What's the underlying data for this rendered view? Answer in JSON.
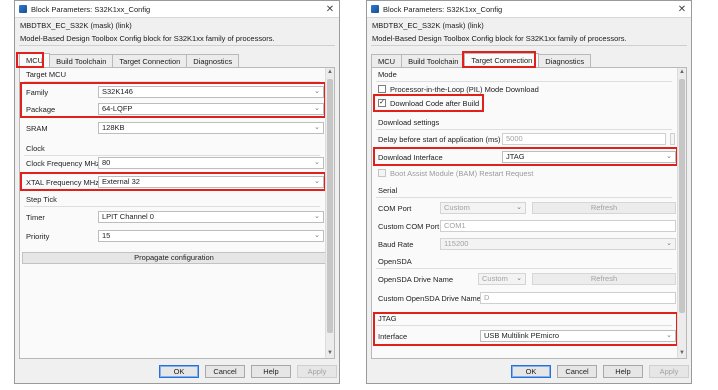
{
  "left": {
    "title": "Block Parameters: S32K1xx_Config",
    "block_name": "MBDTBX_EC_S32K (mask) (link)",
    "description": "Model-Based Design Toolbox Config block for S32K1xx family of processors.",
    "tabs": [
      "MCU",
      "Build Toolchain",
      "Target Connection",
      "Diagnostics"
    ],
    "target_mcu": {
      "title": "Target MCU",
      "family_label": "Family",
      "family_value": "S32K146",
      "package_label": "Package",
      "package_value": "64-LQFP",
      "sram_label": "SRAM",
      "sram_value": "128KB"
    },
    "clock": {
      "title": "Clock",
      "freq_label": "Clock Frequency MHz",
      "freq_value": "80",
      "xtal_label": "XTAL Frequency MHz",
      "xtal_value": "External 32"
    },
    "step_tick": {
      "title": "Step Tick",
      "timer_label": "Timer",
      "timer_value": "LPIT Channel 0",
      "priority_label": "Priority",
      "priority_value": "15"
    },
    "propagate_label": "Propagate configuration",
    "buttons": {
      "ok": "OK",
      "cancel": "Cancel",
      "help": "Help",
      "apply": "Apply"
    }
  },
  "right": {
    "title": "Block Parameters: S32K1xx_Config",
    "block_name": "MBDTBX_EC_S32K (mask) (link)",
    "description": "Model-Based Design Toolbox Config block for S32K1xx family of processors.",
    "tabs": [
      "MCU",
      "Build Toolchain",
      "Target Connection",
      "Diagnostics"
    ],
    "mode": {
      "title": "Mode",
      "pil_label": "Processor-in-the-Loop (PIL) Mode Download",
      "download_after_build_label": "Download Code after Build"
    },
    "download_settings": {
      "title": "Download settings",
      "delay_label": "Delay before start of application (ms)",
      "delay_value": "5000",
      "interface_label": "Download Interface",
      "interface_value": "JTAG",
      "bam_label": "Boot Assist Module (BAM) Restart Request"
    },
    "serial": {
      "title": "Serial",
      "com_port_label": "COM Port",
      "com_port_value": "Custom",
      "refresh_label": "Refresh",
      "custom_com_label": "Custom COM Port",
      "custom_com_value": "COM1",
      "baud_label": "Baud Rate",
      "baud_value": "115200"
    },
    "opensda": {
      "title": "OpenSDA",
      "drive_label": "OpenSDA Drive Name",
      "drive_value": "Custom",
      "refresh_label": "Refresh",
      "custom_drive_label": "Custom OpenSDA Drive Name",
      "custom_drive_value": "D"
    },
    "jtag": {
      "title": "JTAG",
      "interface_label": "Interface",
      "interface_value": "USB Multilink PEmicro"
    },
    "buttons": {
      "ok": "OK",
      "cancel": "Cancel",
      "help": "Help",
      "apply": "Apply"
    }
  },
  "icons": {
    "close": "✕",
    "chevron_down": "⌄",
    "check": "✓",
    "scroll_up": "▲",
    "scroll_down": "▼"
  },
  "colors": {
    "highlight": "#e0201b",
    "default_button_border": "#2a6fd6"
  }
}
